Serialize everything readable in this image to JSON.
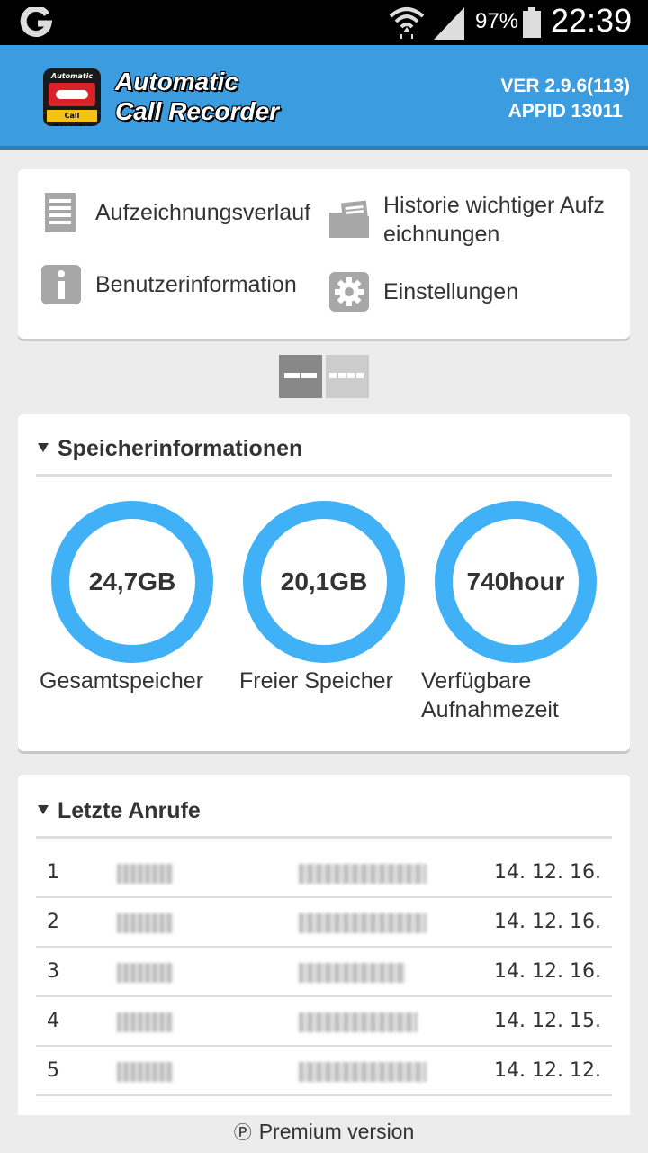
{
  "status_bar": {
    "battery_percent": "97%",
    "time": "22:39",
    "icons": [
      "carrier-logo-icon",
      "wifi-icon",
      "cellular-signal-icon",
      "battery-icon"
    ]
  },
  "header": {
    "title_line1": "Automatic",
    "title_line2": "Call Recorder",
    "logo_top_text": "Automatic",
    "logo_bottom_text": "Call Recorder",
    "version": "VER 2.9.6(113)",
    "appid": "APPID 13011",
    "colors": {
      "bar": "#3b9de0"
    }
  },
  "menu": {
    "items": [
      {
        "label": "Aufzeichnungsverlauf",
        "icon": "document-list-icon"
      },
      {
        "label": "Historie wichtiger Aufzeichnungen",
        "icon": "folder-icon"
      },
      {
        "label": "Benutzerinformation",
        "icon": "info-icon"
      },
      {
        "label": "Einstellungen",
        "icon": "gear-icon"
      }
    ]
  },
  "view_toggle": {
    "selected": "two-column",
    "icons": [
      "two-column-view-icon",
      "four-column-view-icon"
    ]
  },
  "storage": {
    "title": "Speicherinformationen",
    "gauges": [
      {
        "value": "24,7GB",
        "label": "Gesamtspeicher"
      },
      {
        "value": "20,1GB",
        "label": "Freier Speicher"
      },
      {
        "value": "740hour",
        "label": "Verfügbare Aufnahmezeit"
      }
    ],
    "colors": {
      "ring": "#40b1f6"
    }
  },
  "recent_calls": {
    "title": "Letzte Anrufe",
    "rows": [
      {
        "index": "1",
        "date": "14. 12. 16."
      },
      {
        "index": "2",
        "date": "14. 12. 16."
      },
      {
        "index": "3",
        "date": "14. 12. 16."
      },
      {
        "index": "4",
        "date": "14. 12. 15."
      },
      {
        "index": "5",
        "date": "14. 12. 12."
      }
    ]
  },
  "footer": {
    "premium_label": "Premium version",
    "premium_icon": "Ⓟ"
  }
}
